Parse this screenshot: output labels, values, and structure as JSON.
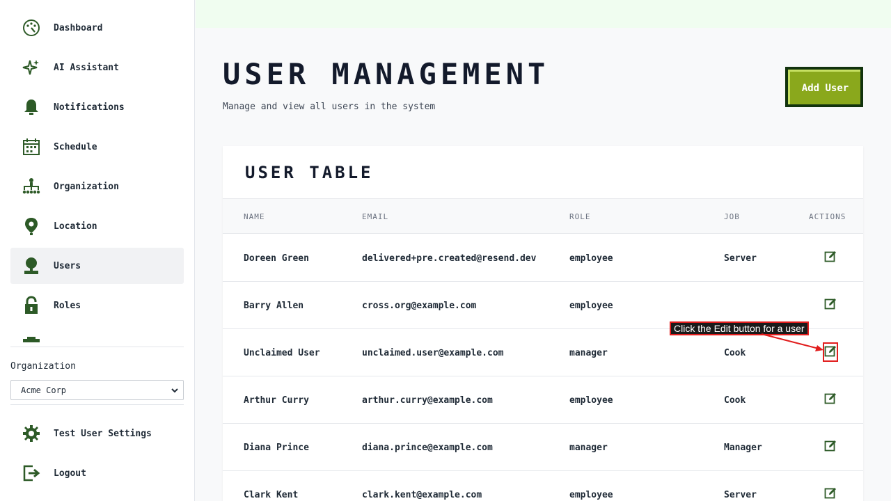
{
  "sidebar": {
    "items": [
      {
        "label": "Dashboard",
        "icon": "dashboard-icon"
      },
      {
        "label": "AI Assistant",
        "icon": "sparkle-icon"
      },
      {
        "label": "Notifications",
        "icon": "bell-icon"
      },
      {
        "label": "Schedule",
        "icon": "calendar-icon"
      },
      {
        "label": "Organization",
        "icon": "org-chart-icon"
      },
      {
        "label": "Location",
        "icon": "map-pin-icon"
      },
      {
        "label": "Users",
        "icon": "user-icon",
        "active": true
      },
      {
        "label": "Roles",
        "icon": "lock-icon"
      }
    ],
    "org_label": "Organization",
    "org_selected": "Acme Corp",
    "settings_label": "Test User Settings",
    "logout_label": "Logout"
  },
  "header": {
    "title": "User Management",
    "subtitle": "Manage and view all users in the system",
    "add_user_label": "Add User"
  },
  "table": {
    "title": "User Table",
    "columns": [
      "Name",
      "Email",
      "Role",
      "Job",
      "Actions"
    ],
    "rows": [
      {
        "name": "Doreen Green",
        "email": "delivered+pre.created@resend.dev",
        "role": "employee",
        "job": "Server"
      },
      {
        "name": "Barry Allen",
        "email": "cross.org@example.com",
        "role": "employee",
        "job": ""
      },
      {
        "name": "Unclaimed User",
        "email": "unclaimed.user@example.com",
        "role": "manager",
        "job": "Cook"
      },
      {
        "name": "Arthur Curry",
        "email": "arthur.curry@example.com",
        "role": "employee",
        "job": "Cook"
      },
      {
        "name": "Diana Prince",
        "email": "diana.prince@example.com",
        "role": "manager",
        "job": "Manager"
      },
      {
        "name": "Clark Kent",
        "email": "clark.kent@example.com",
        "role": "employee",
        "job": "Server"
      }
    ]
  },
  "annotation": {
    "text": "Click the Edit button for a user"
  },
  "colors": {
    "accent_dark_green": "#2d5a27",
    "button_green": "#8aa81c",
    "annotation_red": "#e11d1d"
  }
}
